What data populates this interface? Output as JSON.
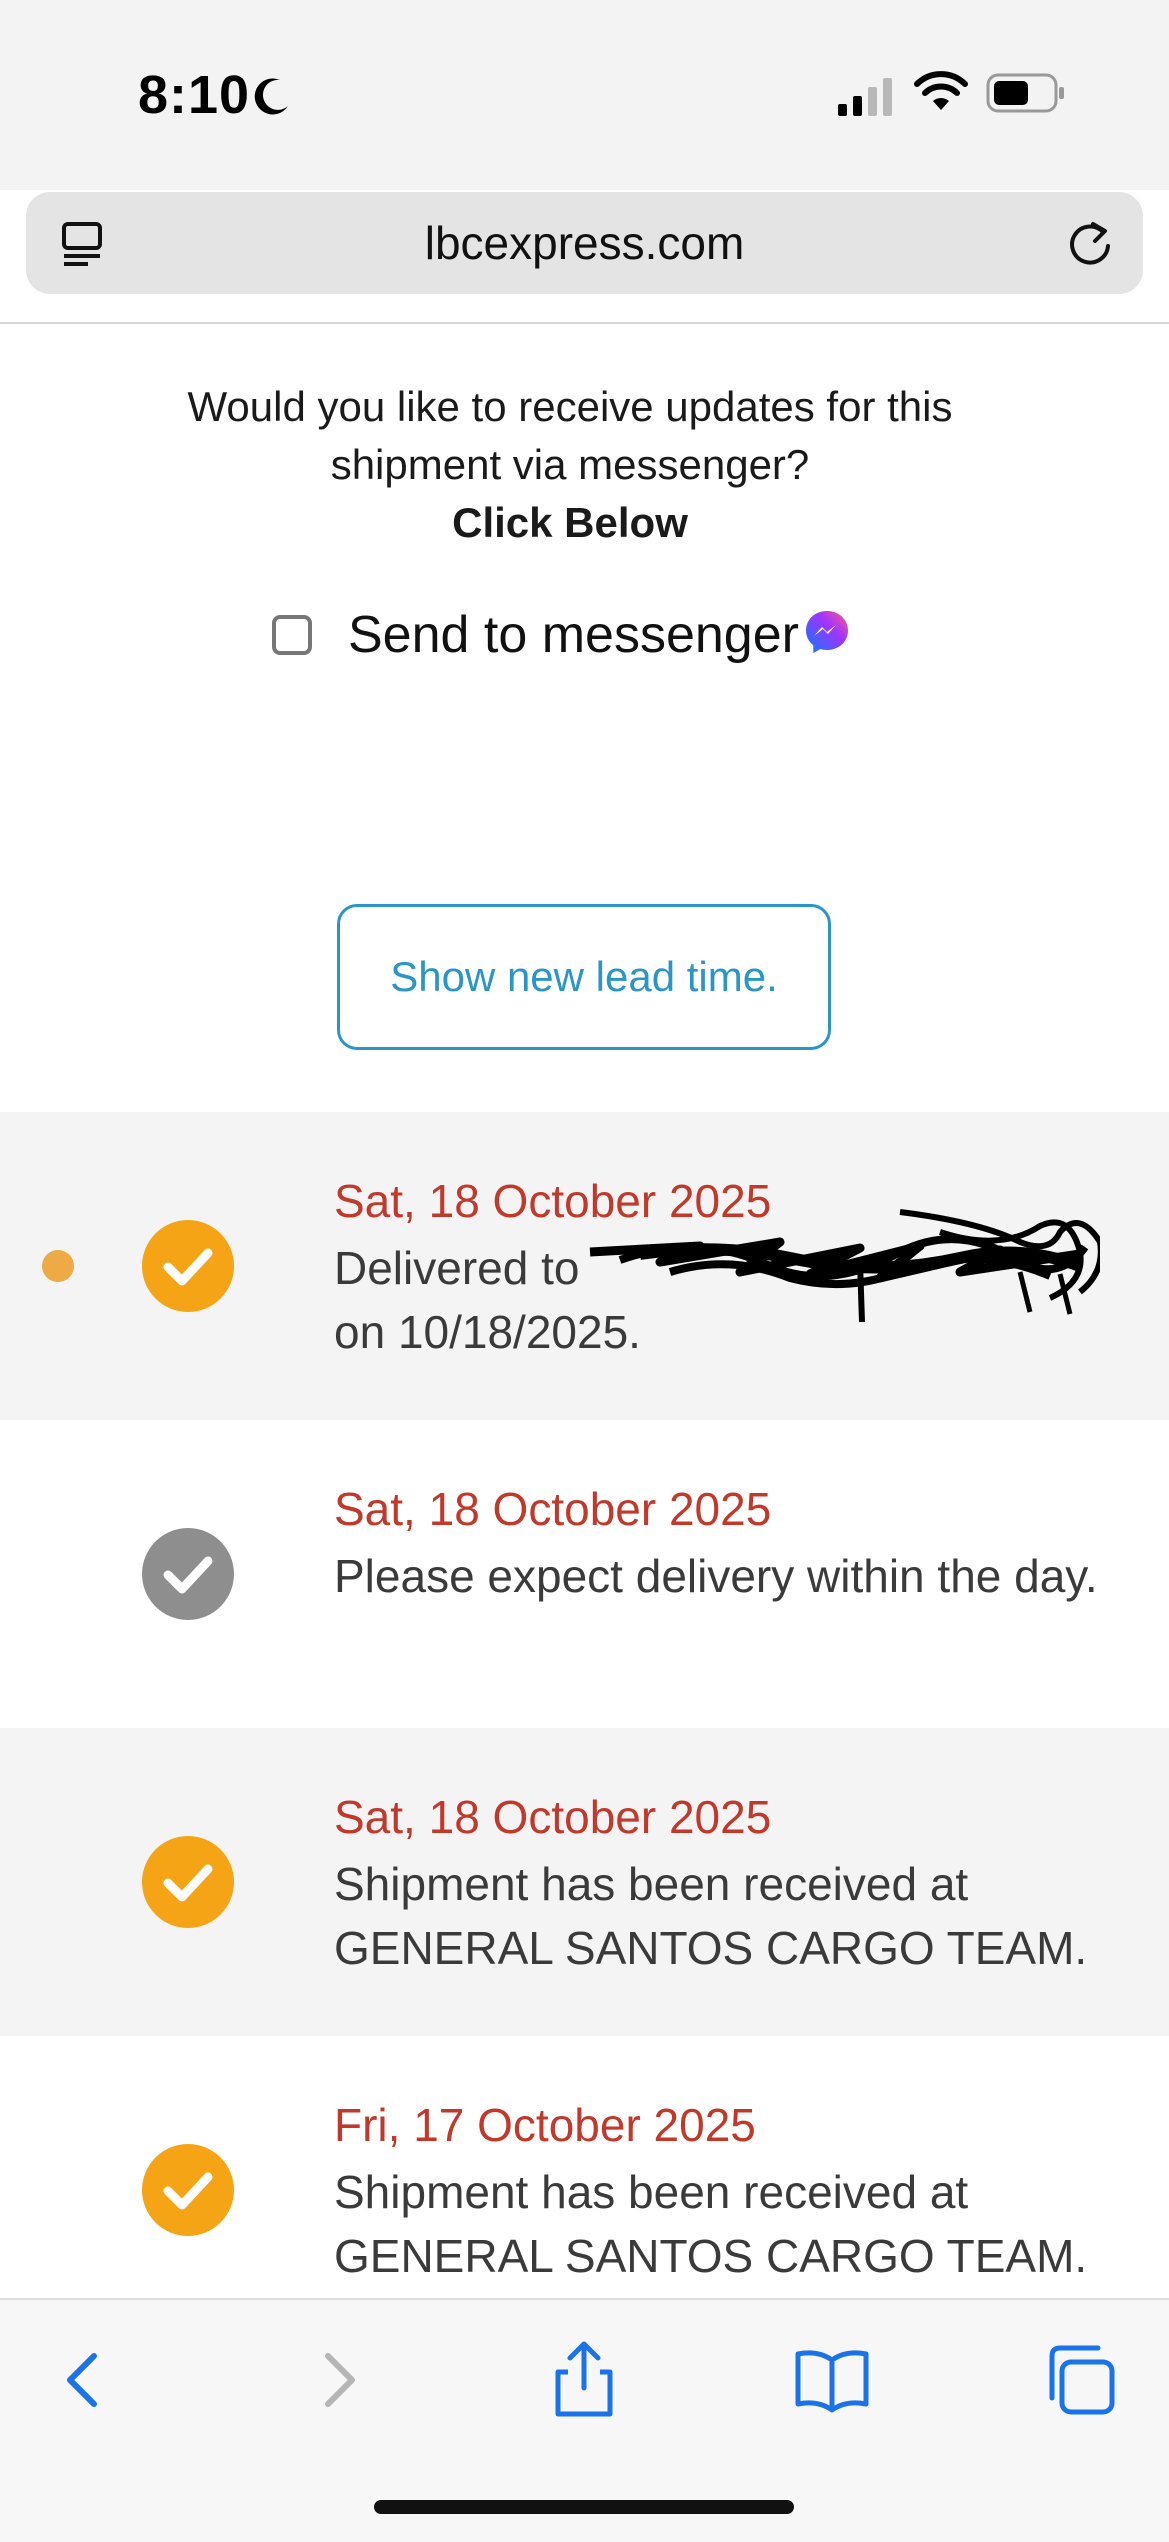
{
  "status_bar": {
    "time": "8:10"
  },
  "browser": {
    "url": "lbcexpress.com"
  },
  "messenger_prompt": {
    "question": "Would you like to receive updates for this shipment via messenger?",
    "instruction": "Click Below",
    "checkbox_label": "Send to messenger",
    "checked": false
  },
  "lead_time_button": {
    "label": "Show new lead time."
  },
  "colors": {
    "date": "#c0392b",
    "check_complete": "#f5a416",
    "check_pending": "#8e8e8e",
    "button_accent": "#2a95c8",
    "current_dot": "#eeaa44"
  },
  "timeline": [
    {
      "date": "Sat, 18 October 2025",
      "description": "Delivered to",
      "description_line2": "on 10/18/2025.",
      "status": "complete",
      "current": true
    },
    {
      "date": "Sat, 18 October 2025",
      "description": "Please expect delivery within the day.",
      "status": "pending",
      "current": false
    },
    {
      "date": "Sat, 18 October 2025",
      "description": "Shipment has been received at GENERAL SANTOS CARGO TEAM.",
      "status": "complete",
      "current": false
    },
    {
      "date": "Fri, 17 October 2025",
      "description": "Shipment has been received at GENERAL SANTOS CARGO TEAM.",
      "status": "complete",
      "current": false
    }
  ]
}
